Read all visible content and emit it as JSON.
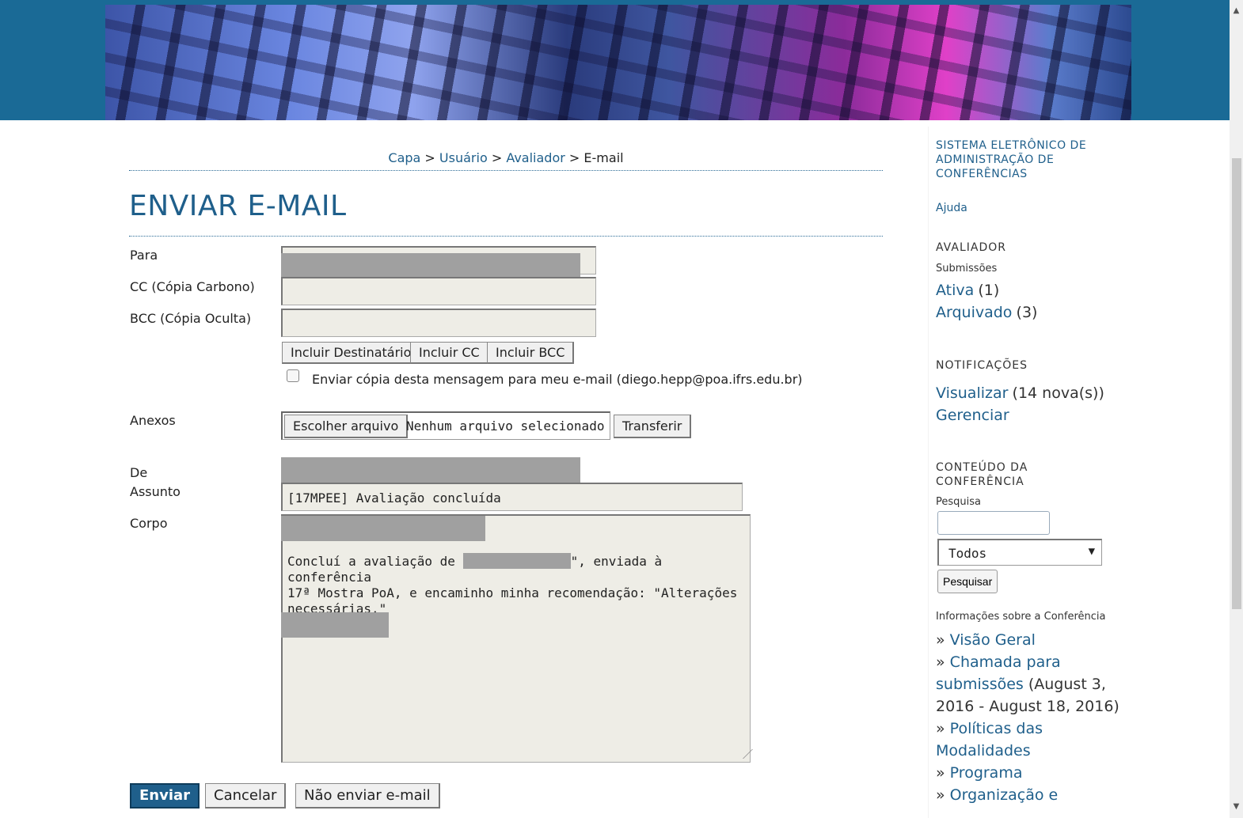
{
  "breadcrumb": {
    "capa": "Capa",
    "sep1": ">",
    "usuario": "Usuário",
    "sep2": ">",
    "avaliador": "Avaliador",
    "sep3": ">",
    "current": "E-mail"
  },
  "page_title": "ENVIAR E-MAIL",
  "form": {
    "to_label": "Para",
    "cc_label": "CC (Cópia Carbono)",
    "bcc_label": "BCC (Cópia Oculta)",
    "cc_value": "",
    "bcc_value": "",
    "buttons": {
      "add_recipient": "Incluir Destinatário",
      "add_cc": "Incluir CC",
      "add_bcc": "Incluir BCC"
    },
    "send_copy_label": "Enviar cópia desta mensagem para meu e-mail (diego.hepp@poa.ifrs.edu.br)",
    "send_copy_checked": false,
    "attachments_label": "Anexos",
    "choose_file": "Escolher arquivo",
    "no_file": "Nenhum arquivo selecionado",
    "upload": "Transferir",
    "from_label": "De",
    "subject_label": "Assunto",
    "subject_value": "[17MPEE] Avaliação concluída",
    "body_label": "Corpo",
    "body_part1": "Concluí a avaliação de ",
    "body_part2": "\", enviada à conferência\n17ª Mostra PoA, e encaminho minha recomendação: \"Alterações\nnecessárias.\""
  },
  "actions": {
    "send": "Enviar",
    "cancel": "Cancelar",
    "skip": "Não enviar e-mail"
  },
  "sidebar": {
    "system_title": "SISTEMA ELETRÔNICO DE ADMINISTRAÇÃO DE CONFERÊNCIAS",
    "help": "Ajuda",
    "reviewer_heading": "AVALIADOR",
    "submissions": "Submissões",
    "active_link": "Ativa",
    "active_count": "(1)",
    "archived_link": "Arquivado",
    "archived_count": "(3)",
    "notifications_heading": "NOTIFICAÇÕES",
    "view_link": "Visualizar",
    "view_count": "(14 nova(s))",
    "manage_link": "Gerenciar",
    "content_heading": "CONTEÚDO DA CONFERÊNCIA",
    "search_label": "Pesquisa",
    "search_value": "",
    "search_scope": "Todos",
    "search_button": "Pesquisar",
    "conf_info_heading": "Informações sobre a Conferência",
    "overview": "Visão Geral",
    "cfp": "Chamada para submissões",
    "cfp_dates": "(August 3, 2016 - August 18, 2016)",
    "policies": "Políticas das Modalidades",
    "program": "Programa",
    "organization": "Organização e"
  },
  "colors": {
    "header_band": "#1a6a96",
    "link": "#1f5f8b",
    "primary_button": "#1f5f8b"
  }
}
